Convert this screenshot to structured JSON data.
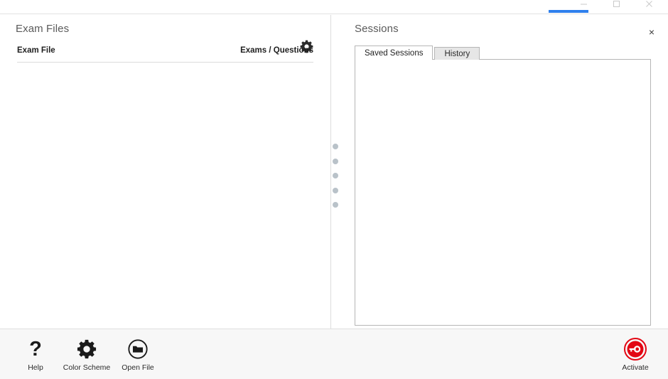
{
  "window": {
    "controls": [
      {
        "name": "minimize",
        "glyph": "minimize-icon"
      },
      {
        "name": "maximize",
        "glyph": "maximize-icon"
      },
      {
        "name": "close",
        "glyph": "close-icon"
      }
    ],
    "accent_color": "#2f80ed"
  },
  "left_panel": {
    "title": "Exam Files",
    "settings_icon": "gear-icon",
    "table": {
      "columns": [
        "Exam File",
        "Exams / Questions"
      ],
      "rows": []
    }
  },
  "splitter": {
    "handle_icon": "grip-dots-icon",
    "dot_count": 5,
    "dot_color": "#b9c2c9"
  },
  "right_panel": {
    "title": "Sessions",
    "close_icon": "close-icon",
    "close_label": "×",
    "tabs": [
      {
        "label": "Saved Sessions",
        "active": true
      },
      {
        "label": "History",
        "active": false
      }
    ],
    "list_items": []
  },
  "toolbar": {
    "buttons": [
      {
        "label": "Help",
        "icon": "question-mark-icon"
      },
      {
        "label": "Color Scheme",
        "icon": "gear-icon"
      },
      {
        "label": "Open File",
        "icon": "folder-open-icon"
      }
    ],
    "activate": {
      "label": "Activate",
      "icon": "key-circle-icon",
      "color": "#e30613"
    }
  }
}
